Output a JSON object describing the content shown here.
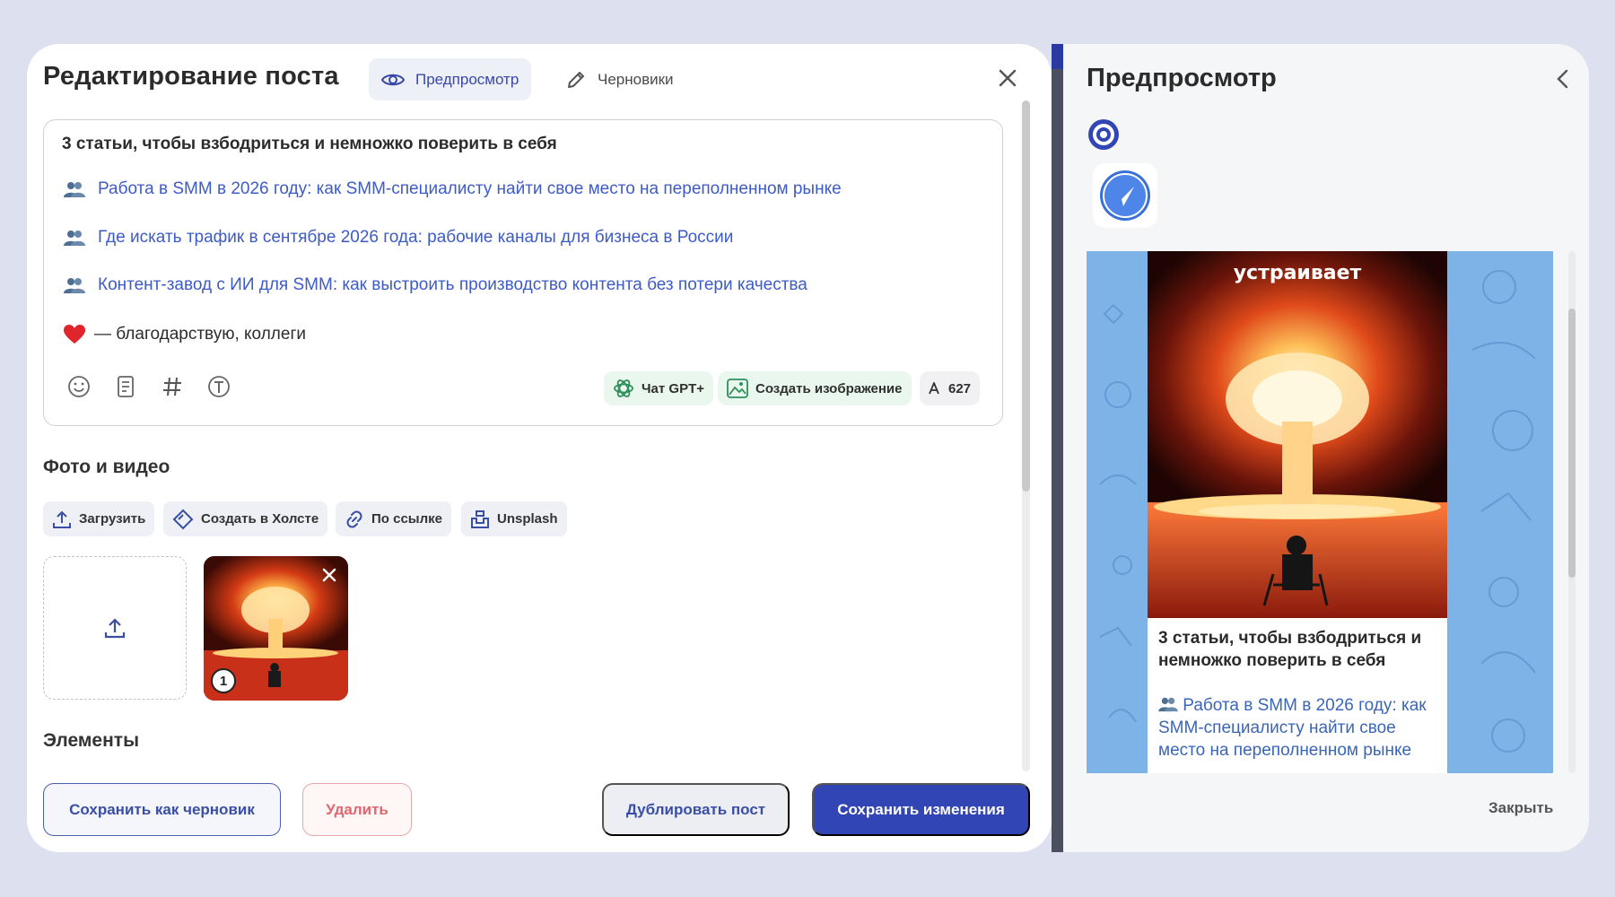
{
  "editor": {
    "title": "Редактирование поста",
    "tabs": {
      "preview_label": "Предпросмотр",
      "drafts_label": "Черновики"
    },
    "post": {
      "heading": "3 статьи, чтобы взбодриться и немножко поверить в себя",
      "links": [
        "Работа в SMM в 2026 году: как SMM-специалисту найти свое место на переполненном рынке",
        "Где искать трафик в сентябре 2026 года: рабочие каналы для бизнеса в России",
        "Контент-завод с ИИ для SMM: как выстроить производство контента без потери качества"
      ],
      "closing": "— благодарствую, коллеги"
    },
    "toolbar": {
      "gpt_label": "Чат GPT+",
      "create_image_label": "Создать изображение",
      "char_count": "627"
    },
    "media": {
      "section_title": "Фото и видео",
      "sources": {
        "upload": "Загрузить",
        "canvas": "Создать в Холсте",
        "link": "По ссылке",
        "unsplash": "Unsplash"
      },
      "thumb_index": "1"
    },
    "elements_title": "Элементы",
    "actions": {
      "save_draft": "Сохранить как черновик",
      "delete": "Удалить",
      "duplicate": "Дублировать пост",
      "save": "Сохранить изменения"
    }
  },
  "preview": {
    "title": "Предпросмотр",
    "image_caption": "устраивает",
    "post_heading": "3 статьи, чтобы взбодриться и немножко поверить в себя",
    "post_link": "Работа в SMM в 2026 году: как SMM-специалисту найти свое место на переполненном рынке",
    "close_label": "Закрыть"
  },
  "colors": {
    "accent": "#3146b4",
    "link": "#3d5bc7",
    "danger": "#e2666f",
    "telegram_bg": "#7eb3e8"
  }
}
